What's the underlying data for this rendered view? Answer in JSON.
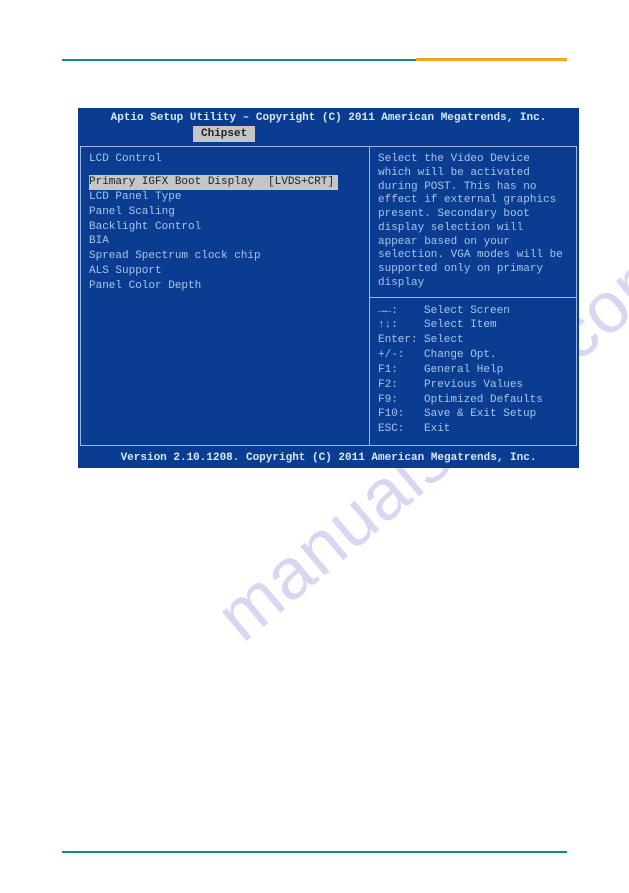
{
  "watermark": "manualshive.com",
  "bios": {
    "title": "Aptio Setup Utility – Copyright (C) 2011 American Megatrends, Inc.",
    "tab": "Chipset",
    "section_title": "LCD Control",
    "selected_item": {
      "label": "Primary IGFX Boot Display",
      "value": "[LVDS+CRT]"
    },
    "items": [
      "LCD Panel Type",
      "Panel Scaling",
      "Backlight Control",
      "BIA",
      "Spread Spectrum clock chip",
      "ALS Support",
      "Panel Color Depth"
    ],
    "help_text": "Select the Video Device which will be activated during POST. This has no effect if external graphics present.\nSecondary boot display selection will appear based on your selection.\nVGA modes will be supported only on primary display",
    "keys": [
      {
        "key": "→←:",
        "action": "Select Screen"
      },
      {
        "key": "↑↓:",
        "action": "Select Item"
      },
      {
        "key": "Enter:",
        "action": "Select"
      },
      {
        "key": "+/-:",
        "action": "Change Opt."
      },
      {
        "key": "F1:",
        "action": "General Help"
      },
      {
        "key": "F2:",
        "action": "Previous Values"
      },
      {
        "key": "F9:",
        "action": "Optimized Defaults"
      },
      {
        "key": "F10:",
        "action": "Save & Exit Setup"
      },
      {
        "key": "ESC:",
        "action": "Exit"
      }
    ],
    "footer": "Version 2.10.1208. Copyright (C) 2011 American Megatrends, Inc."
  }
}
